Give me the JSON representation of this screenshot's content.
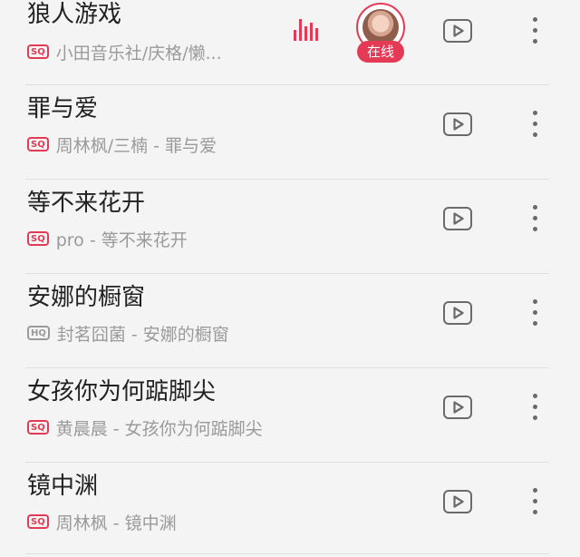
{
  "songs": [
    {
      "title": "狼人游戏",
      "quality": "SQ",
      "subtitle": "小田音乐社/庆格/懒...",
      "playing": true,
      "online_label": "在线"
    },
    {
      "title": "罪与爱",
      "quality": "SQ",
      "subtitle": "周林枫/三楠 - 罪与爱"
    },
    {
      "title": "等不来花开",
      "quality": "SQ",
      "subtitle": "pro - 等不来花开"
    },
    {
      "title": "安娜的橱窗",
      "quality": "HQ",
      "subtitle": "封茗囧菌 - 安娜的橱窗"
    },
    {
      "title": "女孩你为何踮脚尖",
      "quality": "SQ",
      "subtitle": "黄晨晨 - 女孩你为何踮脚尖"
    },
    {
      "title": "镜中渊",
      "quality": "SQ",
      "subtitle": "周林枫 - 镜中渊"
    }
  ],
  "icons": {
    "playing_indicator": "equalizer-icon",
    "video": "play-video-icon",
    "more": "more-vertical-icon",
    "avatar": "avatar"
  },
  "colors": {
    "accent": "#e43a55",
    "title": "#222222",
    "subtitle": "#9a9a9a",
    "icon": "#6a6a6a",
    "background": "#f4f4f4"
  }
}
